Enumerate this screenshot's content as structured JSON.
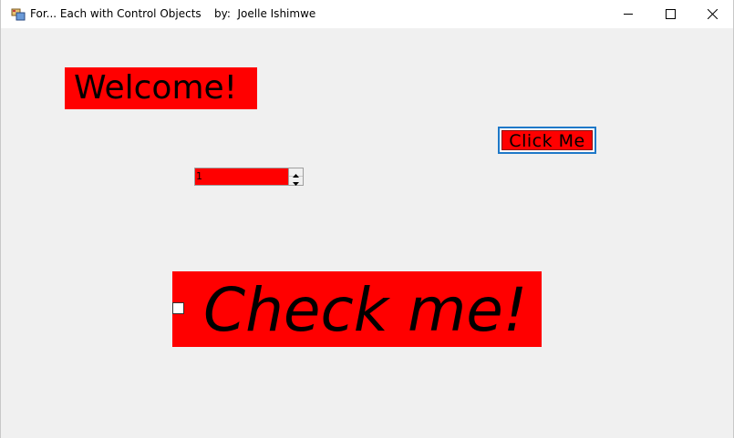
{
  "window": {
    "title": "For... Each with Control Objects",
    "author": "by:  Joelle Ishimwe",
    "controls": {
      "minimize_icon": "minimize-icon",
      "maximize_icon": "maximize-icon",
      "close_icon": "close-icon"
    }
  },
  "form": {
    "welcome_label": "Welcome!",
    "click_button_label": "Click Me",
    "numeric_value": "1",
    "checkbox_label": "Check me!",
    "checkbox_checked": false
  },
  "colors": {
    "control_background": "#ff0000",
    "form_background": "#f0f0f0",
    "focus_border": "#1e78c8"
  }
}
